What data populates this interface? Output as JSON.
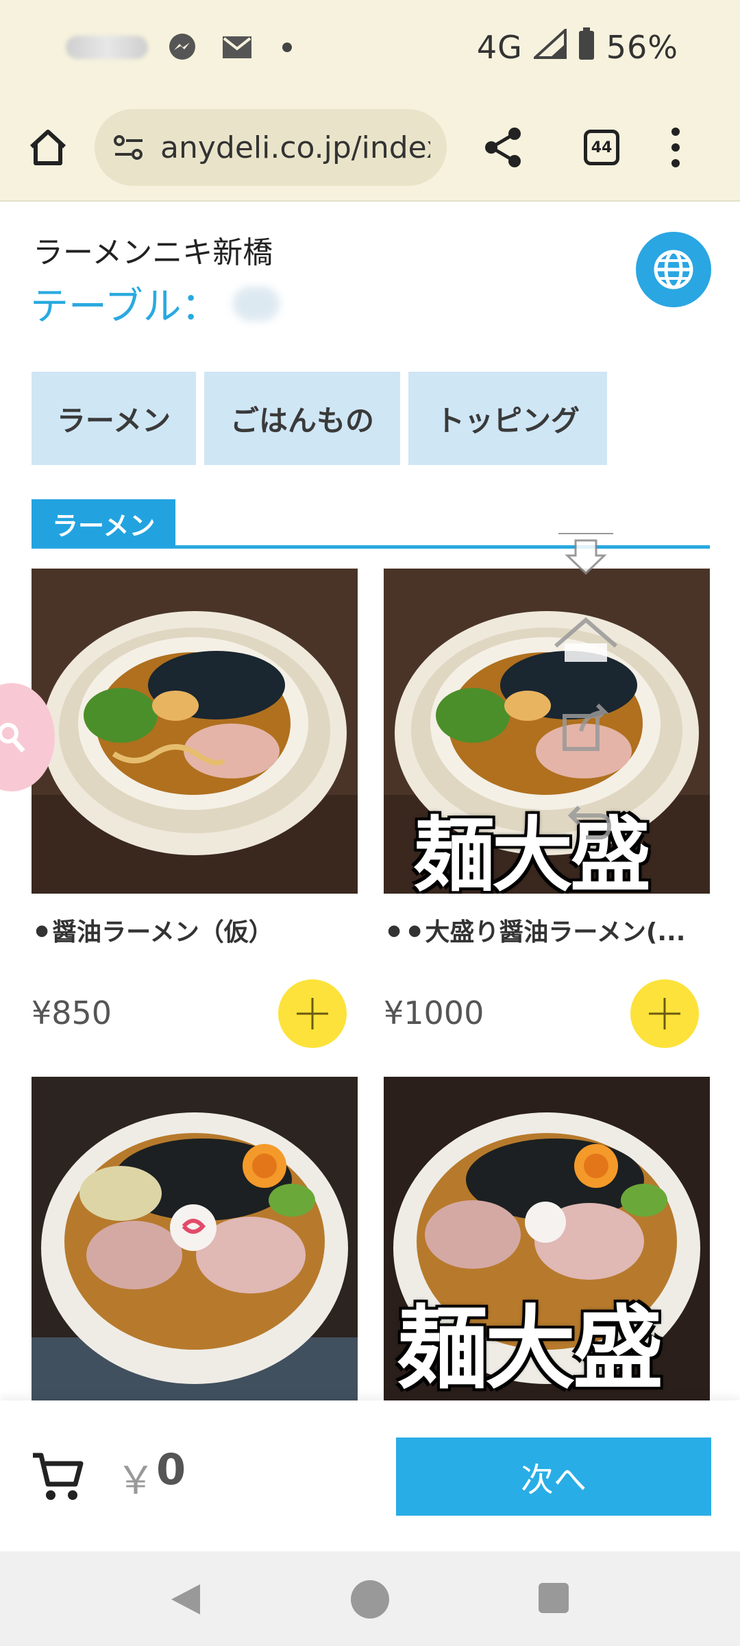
{
  "status_bar": {
    "network": "4G",
    "battery": "56%",
    "icons": [
      "messenger-icon",
      "mail-icon",
      "dot-icon",
      "signal-icon",
      "battery-icon"
    ]
  },
  "browser": {
    "url": "anydeli.co.jp/index.",
    "tab_count": "44"
  },
  "header": {
    "store_name": "ラーメンニキ新橋",
    "table_label": "テーブル："
  },
  "categories": [
    "ラーメン",
    "ごはんもの",
    "トッピング"
  ],
  "section": {
    "title": "ラーメン"
  },
  "items": [
    {
      "name": "⚫醤油ラーメン（仮）",
      "price": "¥850",
      "badge": ""
    },
    {
      "name": "⚫⚫大盛り醤油ラーメン(...",
      "price": "¥1000",
      "badge": "麺大盛"
    },
    {
      "name": "",
      "price": "",
      "badge": ""
    },
    {
      "name": "",
      "price": "",
      "badge": "麺大盛"
    }
  ],
  "cart": {
    "currency": "￥",
    "total": "0",
    "next_label": "次へ"
  },
  "colors": {
    "accent": "#29a9e0",
    "add_button": "#fde23b",
    "category_bg": "#cfe6f5",
    "chrome_bg": "#f6f2dd"
  }
}
